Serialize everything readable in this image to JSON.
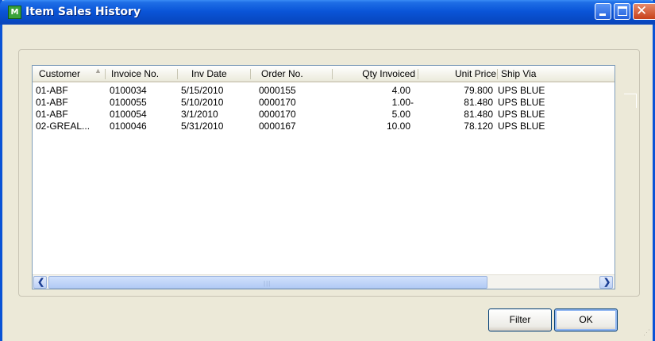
{
  "window": {
    "title": "Item Sales History",
    "app_icon_text": "M"
  },
  "table": {
    "columns": [
      "Customer",
      "Invoice No.",
      "Inv Date",
      "Order No.",
      "Qty Invoiced",
      "Unit Price",
      "Ship Via"
    ],
    "sort_column": "Customer",
    "sort_direction": "ascending",
    "rows": [
      {
        "customer": "01-ABF",
        "invoice_no": "0100034",
        "inv_date": "5/15/2010",
        "order_no": "0000155",
        "qty_invoiced": "4.00",
        "unit_price": "79.800",
        "ship_via": "UPS BLUE"
      },
      {
        "customer": "01-ABF",
        "invoice_no": "0100055",
        "inv_date": "5/10/2010",
        "order_no": "0000170",
        "qty_invoiced": "1.00-",
        "unit_price": "81.480",
        "ship_via": "UPS BLUE"
      },
      {
        "customer": "01-ABF",
        "invoice_no": "0100054",
        "inv_date": "3/1/2010",
        "order_no": "0000170",
        "qty_invoiced": "5.00",
        "unit_price": "81.480",
        "ship_via": "UPS BLUE"
      },
      {
        "customer": "02-GREAL...",
        "invoice_no": "0100046",
        "inv_date": "5/31/2010",
        "order_no": "0000167",
        "qty_invoiced": "10.00",
        "unit_price": "78.120",
        "ship_via": "UPS BLUE"
      }
    ]
  },
  "buttons": {
    "filter": "Filter",
    "ok": "OK"
  },
  "colors": {
    "titlebar": "#0a55d8",
    "dialog_bg": "#ece9d8",
    "list_border": "#7f9db9"
  }
}
